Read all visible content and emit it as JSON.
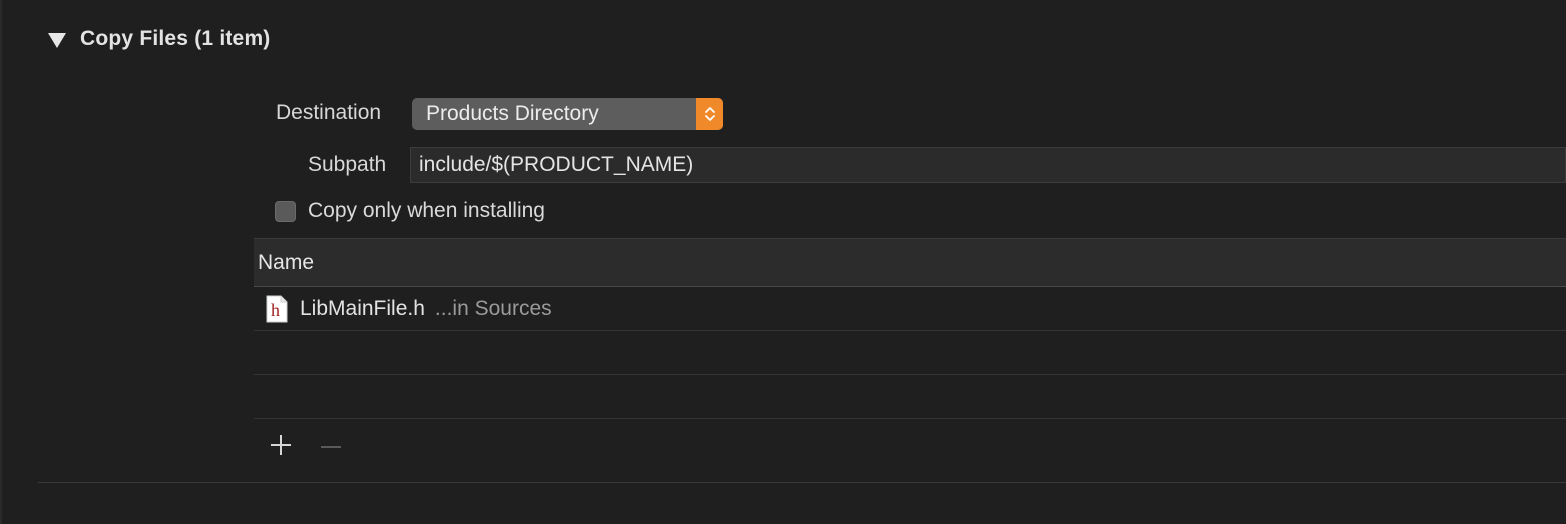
{
  "section": {
    "title": "Copy Files (1 item)"
  },
  "destination": {
    "label": "Destination",
    "value": "Products Directory"
  },
  "subpath": {
    "label": "Subpath",
    "value": "include/$(PRODUCT_NAME)"
  },
  "copy_only_installing": {
    "label": "Copy only when installing",
    "checked": false
  },
  "table": {
    "columns": [
      "Name"
    ],
    "rows": [
      {
        "icon": "header-file-icon",
        "icon_letter": "h",
        "name": "LibMainFile.h",
        "location": "...in Sources"
      }
    ]
  },
  "footer": {
    "add_icon": "plus-icon",
    "remove_icon": "minus-icon"
  },
  "colors": {
    "accent": "#f0892a",
    "background": "#1f1f1f",
    "header_icon_letter": "#a11f1f"
  }
}
